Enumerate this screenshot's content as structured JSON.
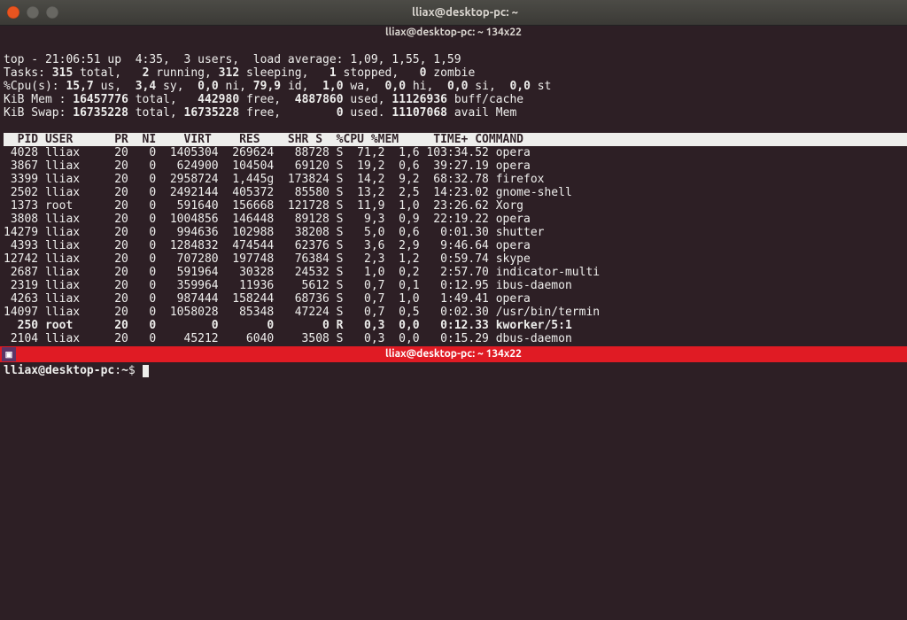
{
  "window": {
    "title": "lliax@desktop-pc: ~"
  },
  "top_pane": {
    "tab_title": "lliax@desktop-pc: ~ 134x22",
    "summary": {
      "line1": "top - 21:06:51 up  4:35,  3 users,  load average: 1,09, 1,55, 1,59",
      "line2_label": "Tasks:",
      "line2_total": "315",
      "line2_rest": " total,   ",
      "line2_running": "2",
      "line2_rest2": " running, ",
      "line2_sleeping": "312",
      "line2_rest3": " sleeping,   ",
      "line2_stopped": "1",
      "line2_rest4": " stopped,   ",
      "line2_zombie": "0",
      "line2_rest5": " zombie",
      "line3_label": "%Cpu(s):",
      "line3_us": " 15,7",
      "line3_sy": "  3,4",
      "line3_ni": "  0,0",
      "line3_id": " 79,9",
      "line3_wa": "  1,0",
      "line3_hi": "  0,0",
      "line3_si": "  0,0",
      "line3_st": "  0,0",
      "line4_label": "KiB Mem :",
      "line4_total": " 16457776",
      "line4_free": "   442980",
      "line4_used": "  4887860",
      "line4_buff": " 11126936",
      "line5_label": "KiB Swap:",
      "line5_total": " 16735228",
      "line5_free": " 16735228",
      "line5_used": "        0",
      "line5_avail": " 11107068"
    },
    "columns_header": "  PID USER      PR  NI    VIRT    RES    SHR S  %CPU %MEM     TIME+ COMMAND                                                              ",
    "processes": [
      {
        "pid": " 4028",
        "user": "lliax   ",
        "pr": "20",
        "ni": "  0",
        "virt": " 1405304",
        "res": " 269624",
        "shr": "  88728",
        "s": "S",
        "cpu": " 71,2",
        "mem": " 1,6",
        "time": "103:34.52",
        "cmd": "opera"
      },
      {
        "pid": " 3867",
        "user": "lliax   ",
        "pr": "20",
        "ni": "  0",
        "virt": "  624900",
        "res": " 104504",
        "shr": "  69120",
        "s": "S",
        "cpu": " 19,2",
        "mem": " 0,6",
        "time": " 39:27.19",
        "cmd": "opera"
      },
      {
        "pid": " 3399",
        "user": "lliax   ",
        "pr": "20",
        "ni": "  0",
        "virt": " 2958724",
        "res": " 1,445g",
        "shr": " 173824",
        "s": "S",
        "cpu": " 14,2",
        "mem": " 9,2",
        "time": " 68:32.78",
        "cmd": "firefox"
      },
      {
        "pid": " 2502",
        "user": "lliax   ",
        "pr": "20",
        "ni": "  0",
        "virt": " 2492144",
        "res": " 405372",
        "shr": "  85580",
        "s": "S",
        "cpu": " 13,2",
        "mem": " 2,5",
        "time": " 14:23.02",
        "cmd": "gnome-shell"
      },
      {
        "pid": " 1373",
        "user": "root    ",
        "pr": "20",
        "ni": "  0",
        "virt": "  591640",
        "res": " 156668",
        "shr": " 121728",
        "s": "S",
        "cpu": " 11,9",
        "mem": " 1,0",
        "time": " 23:26.62",
        "cmd": "Xorg"
      },
      {
        "pid": " 3808",
        "user": "lliax   ",
        "pr": "20",
        "ni": "  0",
        "virt": " 1004856",
        "res": " 146448",
        "shr": "  89128",
        "s": "S",
        "cpu": "  9,3",
        "mem": " 0,9",
        "time": " 22:19.22",
        "cmd": "opera"
      },
      {
        "pid": "14279",
        "user": "lliax   ",
        "pr": "20",
        "ni": "  0",
        "virt": "  994636",
        "res": " 102988",
        "shr": "  38208",
        "s": "S",
        "cpu": "  5,0",
        "mem": " 0,6",
        "time": "  0:01.30",
        "cmd": "shutter"
      },
      {
        "pid": " 4393",
        "user": "lliax   ",
        "pr": "20",
        "ni": "  0",
        "virt": " 1284832",
        "res": " 474544",
        "shr": "  62376",
        "s": "S",
        "cpu": "  3,6",
        "mem": " 2,9",
        "time": "  9:46.64",
        "cmd": "opera"
      },
      {
        "pid": "12742",
        "user": "lliax   ",
        "pr": "20",
        "ni": "  0",
        "virt": "  707280",
        "res": " 197748",
        "shr": "  76384",
        "s": "S",
        "cpu": "  2,3",
        "mem": " 1,2",
        "time": "  0:59.74",
        "cmd": "skype"
      },
      {
        "pid": " 2687",
        "user": "lliax   ",
        "pr": "20",
        "ni": "  0",
        "virt": "  591964",
        "res": "  30328",
        "shr": "  24532",
        "s": "S",
        "cpu": "  1,0",
        "mem": " 0,2",
        "time": "  2:57.70",
        "cmd": "indicator-multi"
      },
      {
        "pid": " 2319",
        "user": "lliax   ",
        "pr": "20",
        "ni": "  0",
        "virt": "  359964",
        "res": "  11936",
        "shr": "   5612",
        "s": "S",
        "cpu": "  0,7",
        "mem": " 0,1",
        "time": "  0:12.95",
        "cmd": "ibus-daemon"
      },
      {
        "pid": " 4263",
        "user": "lliax   ",
        "pr": "20",
        "ni": "  0",
        "virt": "  987444",
        "res": " 158244",
        "shr": "  68736",
        "s": "S",
        "cpu": "  0,7",
        "mem": " 1,0",
        "time": "  1:49.41",
        "cmd": "opera"
      },
      {
        "pid": "14097",
        "user": "lliax   ",
        "pr": "20",
        "ni": "  0",
        "virt": " 1058028",
        "res": "  85348",
        "shr": "  47224",
        "s": "S",
        "cpu": "  0,7",
        "mem": " 0,5",
        "time": "  0:02.30",
        "cmd": "/usr/bin/termin"
      },
      {
        "pid": "  250",
        "user": "root    ",
        "pr": "20",
        "ni": "  0",
        "virt": "       0",
        "res": "      0",
        "shr": "      0",
        "s": "R",
        "cpu": "  0,3",
        "mem": " 0,0",
        "time": "  0:12.33",
        "cmd": "kworker/5:1",
        "bold": true
      },
      {
        "pid": " 2104",
        "user": "lliax   ",
        "pr": "20",
        "ni": "  0",
        "virt": "   45212",
        "res": "   6040",
        "shr": "   3508",
        "s": "S",
        "cpu": "  0,3",
        "mem": " 0,0",
        "time": "  0:15.29",
        "cmd": "dbus-daemon"
      }
    ]
  },
  "divider": {
    "title": "lliax@desktop-pc: ~ 134x22"
  },
  "bottom_pane": {
    "prompt_user": "lliax@desktop-pc",
    "prompt_sep": ":",
    "prompt_path": "~",
    "prompt_char": "$"
  }
}
